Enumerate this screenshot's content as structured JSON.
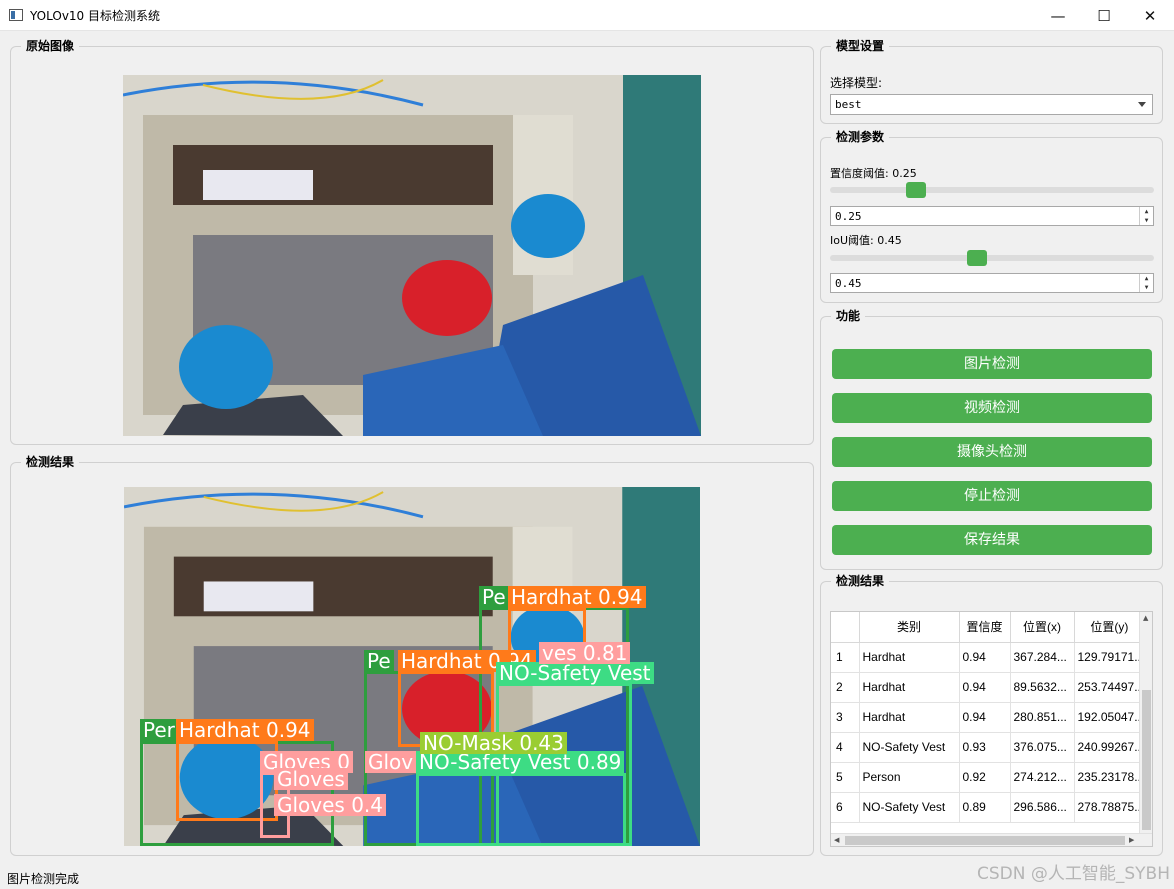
{
  "window": {
    "title": "YOLOv10 目标检测系统",
    "controls": {
      "minimize": "—",
      "maximize": "☐",
      "close": "✕"
    }
  },
  "panels": {
    "original": {
      "title": "原始图像"
    },
    "result": {
      "title": "检测结果"
    }
  },
  "model_settings": {
    "title": "模型设置",
    "select_label": "选择模型:",
    "selected_model": "best"
  },
  "params": {
    "title": "检测参数",
    "confidence_label": "置信度阈值: 0.25",
    "confidence_value": "0.25",
    "confidence_level": 0.25,
    "iou_label": "IoU阈值: 0.45",
    "iou_value": "0.45",
    "iou_level": 0.45
  },
  "functions": {
    "title": "功能",
    "image_detect": "图片检测",
    "video_detect": "视频检测",
    "camera_detect": "摄像头检测",
    "stop_detect": "停止检测",
    "save_result": "保存结果"
  },
  "results_table": {
    "title": "检测结果",
    "headers": [
      "类别",
      "置信度",
      "位置(x)",
      "位置(y)"
    ],
    "rows": [
      {
        "n": "1",
        "cls": "Hardhat",
        "conf": "0.94",
        "x": "367.284...",
        "y": "129.79171..."
      },
      {
        "n": "2",
        "cls": "Hardhat",
        "conf": "0.94",
        "x": "89.5632...",
        "y": "253.74497..."
      },
      {
        "n": "3",
        "cls": "Hardhat",
        "conf": "0.94",
        "x": "280.851...",
        "y": "192.05047..."
      },
      {
        "n": "4",
        "cls": "NO-Safety Vest",
        "conf": "0.93",
        "x": "376.075...",
        "y": "240.99267..."
      },
      {
        "n": "5",
        "cls": "Person",
        "conf": "0.92",
        "x": "274.212...",
        "y": "235.23178..."
      },
      {
        "n": "6",
        "cls": "NO-Safety Vest",
        "conf": "0.89",
        "x": "296.586...",
        "y": "278.78875..."
      }
    ]
  },
  "detection_labels": {
    "hardhat_1": "Hardhat 0.94",
    "hardhat_2": "Hardhat 0.94",
    "hardhat_3": "Hardhat 0.94",
    "person_1": "Pe",
    "person_2": "Pe",
    "person_3": "Per",
    "vest_1": "NO-Safety Vest",
    "vest_2": "NO-Safety Vest 0.89",
    "mask_1": "NO-Mask 0.43",
    "gloves_1": "Gloves 0",
    "gloves_2": "Gloves",
    "gloves_3": "Glov",
    "gloves_4": "Gloves 0.4",
    "gloves_5": "ves 0.81"
  },
  "status_bar": {
    "text": "图片检测完成"
  },
  "watermark": "CSDN @人工智能_SYBH",
  "colors": {
    "accent_green": "#4caf50",
    "hardhat_box": "#ff7a1a",
    "person_box": "#2e9e3e",
    "vest_box": "#3ddc84",
    "gloves_box": "#ff9e9e",
    "mask_box": "#9acd32"
  }
}
